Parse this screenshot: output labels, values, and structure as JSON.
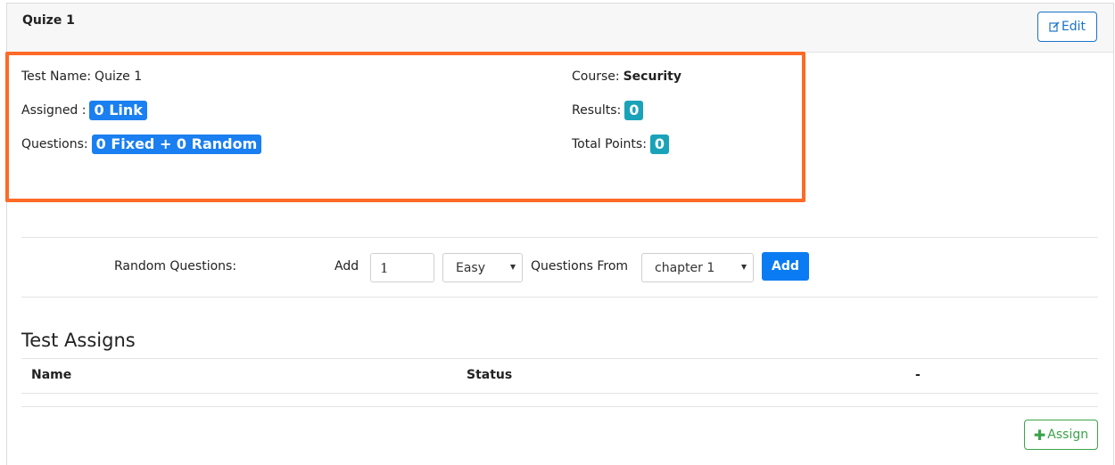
{
  "header": {
    "title": "Quize 1",
    "edit_label": "Edit"
  },
  "details": {
    "test_name_label": "Test Name:",
    "test_name_value": "Quize 1",
    "assigned_label": "Assigned :",
    "assigned_badge": "0 Link",
    "questions_label": "Questions:",
    "questions_badge": "0 Fixed + 0 Random",
    "course_label": "Course:",
    "course_value": "Security",
    "results_label": "Results:",
    "results_badge": "0",
    "total_points_label": "Total Points:",
    "total_points_badge": "0"
  },
  "random_questions": {
    "label": "Random Questions:",
    "add_label": "Add",
    "count_value": "1",
    "difficulty_selected": "Easy",
    "from_label": "Questions From",
    "chapter_selected": "chapter 1",
    "add_button": "Add"
  },
  "assigns": {
    "title": "Test Assigns",
    "columns": [
      "Name",
      "Status",
      "-"
    ],
    "assign_button": "Assign"
  },
  "colors": {
    "highlight": "#ff6a26",
    "primary": "#0a7bf2",
    "teal": "#1aa3b8",
    "success": "#3aa34a"
  }
}
